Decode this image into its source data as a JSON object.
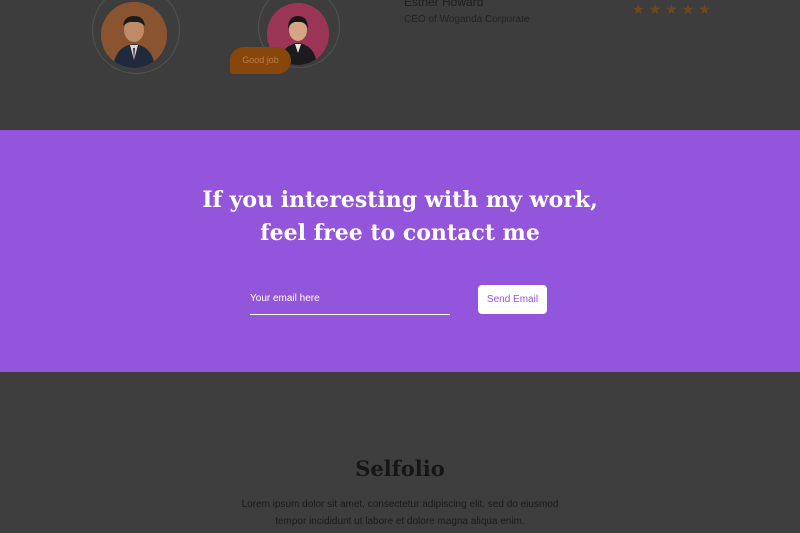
{
  "testimonial": {
    "name": "Esther Howard",
    "role": "CEO of Woganda Corporate",
    "bubble_text": "Good job",
    "rating": 5,
    "star_glyph": "★",
    "colors": {
      "star": "#6c4a1c",
      "bubble": "#87460c"
    }
  },
  "contact": {
    "headline_line1": "If you interesting with my work,",
    "headline_line2": "feel free to contact me",
    "email_placeholder": "Your email here",
    "send_label": "Send Email",
    "colors": {
      "background": "#9355db",
      "button_text": "#9355db"
    }
  },
  "footer": {
    "brand": "Selfolio",
    "description": "Lorem ipsum dolor sit amet, consectetur adipiscing elit, sed do eiusmod tempor incididunt ut labore et dolore magna aliqua enim."
  }
}
